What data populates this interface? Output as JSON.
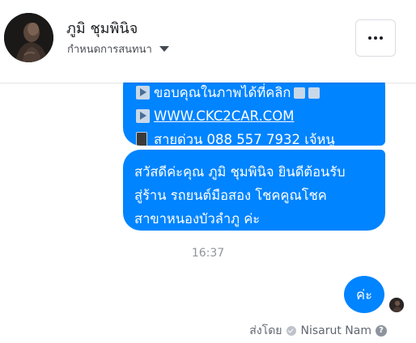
{
  "header": {
    "contact_name": "ภูมิ ชุมพินิจ",
    "status": "กำหนดการสนทนา",
    "more_icon": "more-horizontal-icon"
  },
  "conversation": {
    "previous_message": {
      "line1": "ขอบคุณในภาพได้ที่คลิก",
      "link": "WWW.CKC2CAR.COM",
      "hotline": "สายด่วน 088 557 7932 เจ้หนู"
    },
    "page_message": "สวัสดีค่ะคุณ ภูมิ ชุมพินิจ ยินดีต้อนรับ\nสู่ร้าน รถยนต์มือสอง โชคคูณโชค\nสาขาหนองบัวลำภู ค่ะ",
    "timestamp": "16:37",
    "reply": "ค่ะ",
    "sent_by_label": "ส่งโดย",
    "sender_name": "Nisarut Nam",
    "help_glyph": "?"
  },
  "colors": {
    "bubble": "#0084ff",
    "text": "#1c1e21",
    "muted": "#90949c"
  }
}
